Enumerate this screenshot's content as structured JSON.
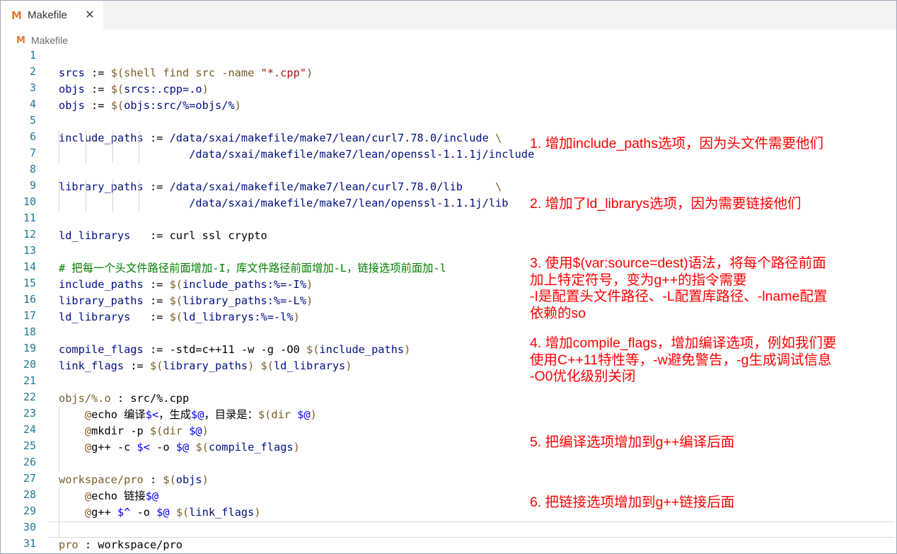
{
  "tab": {
    "title": "Makefile",
    "icon": "makefile-icon",
    "icon_glyph": "M",
    "close_glyph": "✕"
  },
  "breadcrumb": {
    "icon_glyph": "M",
    "label": "Makefile"
  },
  "editor": {
    "current_line": 30,
    "lines": [
      {
        "n": "1",
        "tokens": []
      },
      {
        "n": "2",
        "tokens": [
          [
            "v",
            "srcs"
          ],
          [
            "o",
            " := "
          ],
          [
            "f",
            "$(shell find src -name "
          ],
          [
            "s",
            "\"*.cpp\""
          ],
          [
            "f",
            ")"
          ]
        ]
      },
      {
        "n": "3",
        "tokens": [
          [
            "v",
            "objs"
          ],
          [
            "o",
            " := "
          ],
          [
            "f",
            "$("
          ],
          [
            "v",
            "srcs:.cpp=.o"
          ],
          [
            "f",
            ")"
          ]
        ]
      },
      {
        "n": "4",
        "tokens": [
          [
            "v",
            "objs"
          ],
          [
            "o",
            " := "
          ],
          [
            "f",
            "$("
          ],
          [
            "v",
            "objs:src/%=objs/%"
          ],
          [
            "f",
            ")"
          ]
        ]
      },
      {
        "n": "5",
        "tokens": []
      },
      {
        "n": "6",
        "tokens": [
          [
            "v",
            "include_paths"
          ],
          [
            "o",
            " := "
          ],
          [
            "v",
            "/data/sxai/makefile/make7/lean/curl7.78.0/include "
          ],
          [
            "f",
            "\\"
          ]
        ]
      },
      {
        "n": "7",
        "tokens": [
          [
            "v",
            "                    /data/sxai/makefile/make7/lean/openssl-1.1.1j/include"
          ]
        ]
      },
      {
        "n": "8",
        "tokens": []
      },
      {
        "n": "9",
        "tokens": [
          [
            "v",
            "library_paths"
          ],
          [
            "o",
            " := "
          ],
          [
            "v",
            "/data/sxai/makefile/make7/lean/curl7.78.0/lib     "
          ],
          [
            "f",
            "\\"
          ]
        ]
      },
      {
        "n": "10",
        "tokens": [
          [
            "v",
            "                    /data/sxai/makefile/make7/lean/openssl-1.1.1j/lib"
          ]
        ]
      },
      {
        "n": "11",
        "tokens": []
      },
      {
        "n": "12",
        "tokens": [
          [
            "v",
            "ld_librarys"
          ],
          [
            "o",
            "   := "
          ],
          [
            "p",
            "curl ssl crypto"
          ]
        ]
      },
      {
        "n": "13",
        "tokens": []
      },
      {
        "n": "14",
        "tokens": [
          [
            "c",
            "# 把每一个头文件路径前面增加-I，库文件路径前面增加-L，链接选项前面加-l"
          ]
        ]
      },
      {
        "n": "15",
        "tokens": [
          [
            "v",
            "include_paths"
          ],
          [
            "o",
            " := "
          ],
          [
            "f",
            "$("
          ],
          [
            "v",
            "include_paths:%=-I%"
          ],
          [
            "f",
            ")"
          ]
        ]
      },
      {
        "n": "16",
        "tokens": [
          [
            "v",
            "library_paths"
          ],
          [
            "o",
            " := "
          ],
          [
            "f",
            "$("
          ],
          [
            "v",
            "library_paths:%=-L%"
          ],
          [
            "f",
            ")"
          ]
        ]
      },
      {
        "n": "17",
        "tokens": [
          [
            "v",
            "ld_librarys"
          ],
          [
            "o",
            "   := "
          ],
          [
            "f",
            "$("
          ],
          [
            "v",
            "ld_librarys:%=-l%"
          ],
          [
            "f",
            ")"
          ]
        ]
      },
      {
        "n": "18",
        "tokens": []
      },
      {
        "n": "19",
        "tokens": [
          [
            "v",
            "compile_flags"
          ],
          [
            "o",
            " := "
          ],
          [
            "p",
            "-std=c++11 -w -g -O0 "
          ],
          [
            "f",
            "$("
          ],
          [
            "v",
            "include_paths"
          ],
          [
            "f",
            ")"
          ]
        ]
      },
      {
        "n": "20",
        "tokens": [
          [
            "v",
            "link_flags"
          ],
          [
            "o",
            " := "
          ],
          [
            "f",
            "$("
          ],
          [
            "v",
            "library_paths"
          ],
          [
            "f",
            ") $("
          ],
          [
            "v",
            "ld_librarys"
          ],
          [
            "f",
            ")"
          ]
        ]
      },
      {
        "n": "21",
        "tokens": []
      },
      {
        "n": "22",
        "tokens": [
          [
            "f",
            "objs/%.o"
          ],
          [
            "o",
            " : "
          ],
          [
            "p",
            "src/%.cpp"
          ]
        ]
      },
      {
        "n": "23",
        "tokens": [
          [
            "p",
            "    "
          ],
          [
            "f",
            "@"
          ],
          [
            "p",
            "echo 编译"
          ],
          [
            "a",
            "$<"
          ],
          [
            "p",
            "，生成"
          ],
          [
            "a",
            "$@"
          ],
          [
            "p",
            "，目录是："
          ],
          [
            "f",
            "$(dir "
          ],
          [
            "a",
            "$@"
          ],
          [
            "f",
            ")"
          ]
        ]
      },
      {
        "n": "24",
        "tokens": [
          [
            "p",
            "    "
          ],
          [
            "f",
            "@"
          ],
          [
            "p",
            "mkdir -p "
          ],
          [
            "f",
            "$(dir "
          ],
          [
            "a",
            "$@"
          ],
          [
            "f",
            ")"
          ]
        ]
      },
      {
        "n": "25",
        "tokens": [
          [
            "p",
            "    "
          ],
          [
            "f",
            "@"
          ],
          [
            "p",
            "g++ -c "
          ],
          [
            "a",
            "$<"
          ],
          [
            "p",
            " -o "
          ],
          [
            "a",
            "$@"
          ],
          [
            "p",
            " "
          ],
          [
            "f",
            "$("
          ],
          [
            "v",
            "compile_flags"
          ],
          [
            "f",
            ")"
          ]
        ]
      },
      {
        "n": "26",
        "tokens": []
      },
      {
        "n": "27",
        "tokens": [
          [
            "f",
            "workspace/pro"
          ],
          [
            "o",
            " : "
          ],
          [
            "f",
            "$("
          ],
          [
            "v",
            "objs"
          ],
          [
            "f",
            ")"
          ]
        ]
      },
      {
        "n": "28",
        "tokens": [
          [
            "p",
            "    "
          ],
          [
            "f",
            "@"
          ],
          [
            "p",
            "echo 链接"
          ],
          [
            "a",
            "$@"
          ]
        ]
      },
      {
        "n": "29",
        "tokens": [
          [
            "p",
            "    "
          ],
          [
            "f",
            "@"
          ],
          [
            "p",
            "g++ "
          ],
          [
            "a",
            "$^"
          ],
          [
            "p",
            " -o "
          ],
          [
            "a",
            "$@"
          ],
          [
            "p",
            " "
          ],
          [
            "f",
            "$("
          ],
          [
            "v",
            "link_flags"
          ],
          [
            "f",
            ")"
          ]
        ]
      },
      {
        "n": "30",
        "tokens": []
      },
      {
        "n": "31",
        "tokens": [
          [
            "f",
            "pro"
          ],
          [
            "o",
            " : "
          ],
          [
            "p",
            "workspace/pro"
          ]
        ]
      }
    ]
  },
  "annotations": [
    {
      "text": "1. 增加include_paths选项，因为头文件需要他们"
    },
    {
      "text": "2. 增加了ld_librarys选项，因为需要链接他们"
    },
    {
      "text": "3. 使用$(var:source=dest)语法，将每个路径前面\n加上特定符号，变为g++的指令需要\n-I是配置头文件路径、-L配置库路径、-lname配置\n依赖的so"
    },
    {
      "text": "4. 增加compile_flags，增加编译选项，例如我们要\n使用C++11特性等，-w避免警告，-g生成调试信息\n-O0优化级别关闭"
    },
    {
      "text": "5. 把编译选项增加到g++编译后面"
    },
    {
      "text": "6. 把链接选项增加到g++链接后面"
    }
  ],
  "colors": {
    "annotation": "#ff0000",
    "line_number": "#237893",
    "makefile_icon": "#e37933"
  }
}
